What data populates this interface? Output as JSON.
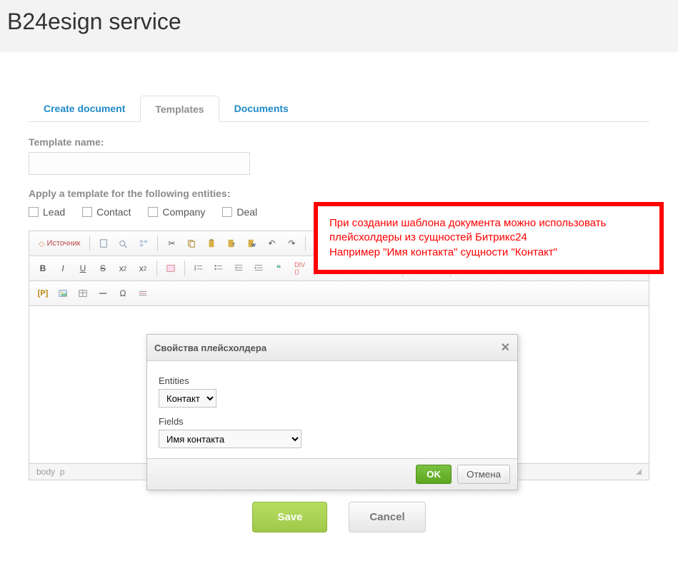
{
  "header": {
    "title": "B24esign service"
  },
  "tabs": {
    "create": "Create document",
    "templates": "Templates",
    "documents": "Documents"
  },
  "form": {
    "name_label": "Template name:",
    "name_value": "",
    "apply_label": "Apply a template for the following entities:",
    "entities": {
      "lead": "Lead",
      "contact": "Contact",
      "company": "Company",
      "deal": "Deal"
    }
  },
  "editor": {
    "source": "Источник",
    "path_body": "body",
    "path_p": "p"
  },
  "dialog": {
    "title": "Свойства плейсхолдера",
    "entities_label": "Entities",
    "entities_value": "Контакт",
    "fields_label": "Fields",
    "fields_value": "Имя контакта",
    "ok": "OK",
    "cancel": "Отмена"
  },
  "callout": {
    "line1": "При создании шаблона документа можно использовать плейсхолдеры из сущностей Битрикс24",
    "line2": "Например \"Имя контакта\" сущности \"Контакт\""
  },
  "buttons": {
    "save": "Save",
    "cancel": "Cancel"
  }
}
